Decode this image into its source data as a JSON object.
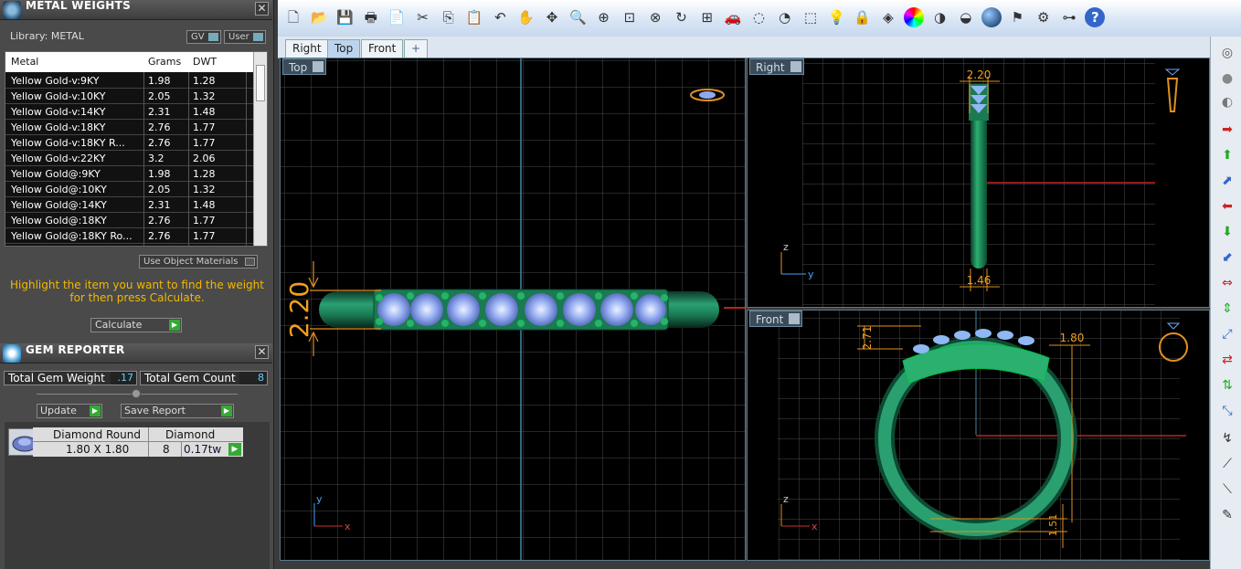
{
  "metal_weights": {
    "title": "METAL WEIGHTS",
    "library": "Library: METAL",
    "gv_label": "GV",
    "user_label": "User",
    "columns": [
      "Metal",
      "Grams",
      "DWT"
    ],
    "rows": [
      [
        "Yellow Gold-v:9KY",
        "1.98",
        "1.28"
      ],
      [
        "Yellow Gold-v:10KY",
        "2.05",
        "1.32"
      ],
      [
        "Yellow Gold-v:14KY",
        "2.31",
        "1.48"
      ],
      [
        "Yellow Gold-v:18KY",
        "2.76",
        "1.77"
      ],
      [
        "Yellow Gold-v:18KY R...",
        "2.76",
        "1.77"
      ],
      [
        "Yellow Gold-v:22KY",
        "3.2",
        "2.06"
      ],
      [
        "Yellow Gold@:9KY",
        "1.98",
        "1.28"
      ],
      [
        "Yellow Gold@:10KY",
        "2.05",
        "1.32"
      ],
      [
        "Yellow Gold@:14KY",
        "2.31",
        "1.48"
      ],
      [
        "Yellow Gold@:18KY",
        "2.76",
        "1.77"
      ],
      [
        "Yellow Gold@:18KY Ro...",
        "2.76",
        "1.77"
      ]
    ],
    "use_object_materials": "Use Object Materials",
    "hint": "Highlight the item you want to find the weight for then press Calculate.",
    "calculate": "Calculate"
  },
  "gem_reporter": {
    "title": "GEM REPORTER",
    "total_weight_label": "Total Gem Weight",
    "total_weight_value": ".17",
    "total_count_label": "Total Gem Count",
    "total_count_value": "8",
    "update": "Update",
    "save_report": "Save Report",
    "gem_shape": "Diamond Round",
    "gem_type": "Diamond",
    "gem_size": "1.80 X 1.80",
    "gem_count": "8",
    "gem_weight": "0.17tw"
  },
  "tabs": [
    "Right",
    "Top",
    "Front",
    "+"
  ],
  "viewports": {
    "top": {
      "label": "Top",
      "dim": "2.20",
      "axis_y": "y",
      "axis_x": "x"
    },
    "right": {
      "label": "Right",
      "dim_top": "2.20",
      "dim_bottom": "1.46",
      "axis_z": "z",
      "axis_y": "y"
    },
    "front": {
      "label": "Front",
      "dim_left": "2.71",
      "dim_right": "1.80",
      "dim_bottom": "1.51",
      "axis_z": "z",
      "axis_x": "x"
    }
  },
  "toolbar_icons": [
    "new-icon",
    "open-icon",
    "save-icon",
    "print-icon",
    "copy-doc-icon",
    "cut-icon",
    "copy-icon",
    "paste-icon",
    "undo-icon",
    "pan-icon",
    "rotate-icon",
    "zoom-icon",
    "zoom-window-icon",
    "zoom-extents-icon",
    "zoom-selected-icon",
    "rotate-view-icon",
    "four-views-icon",
    "car-icon",
    "hide-icon",
    "snap-icon",
    "grid-icon",
    "light-icon",
    "lock-icon",
    "layer-icon",
    "color-icon",
    "shade-icon",
    "render-icon",
    "sphere-icon",
    "magic-icon",
    "settings-icon",
    "hierarchy-icon",
    "help-icon"
  ],
  "colors": {
    "accent_gold": "#f2b800",
    "grid": "#4a4a4a",
    "ring_green": "#1f8a5a",
    "gem_blue": "#8fa8f0"
  }
}
